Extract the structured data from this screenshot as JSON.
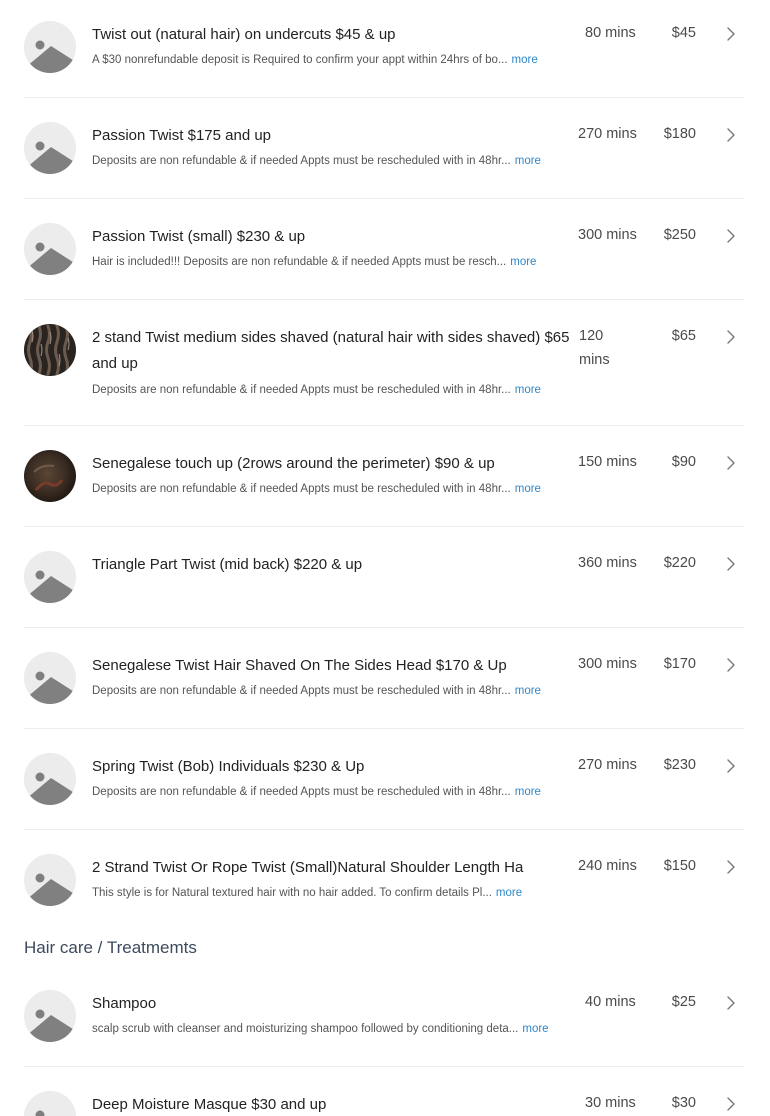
{
  "colors": {
    "link": "#2f87c8",
    "divider": "#eeeeee",
    "section": "#3c4b5c"
  },
  "services": [
    {
      "title": "Twist out (natural hair) on undercuts $45 & up",
      "desc": "A $30 nonrefundable deposit  is Required to confirm your appt  within 24hrs of bo...",
      "more": "more",
      "duration": "80 mins",
      "price": "$45",
      "thumb": "placeholder-image-icon"
    },
    {
      "title": "Passion Twist $175 and up",
      "desc": "Deposits are non refundable  & if  needed Appts must be rescheduled  with in 48hr...",
      "more": "more",
      "duration": "270 mins",
      "price": "$180",
      "thumb": "placeholder-image-icon"
    },
    {
      "title": "Passion Twist (small) $230 & up",
      "desc": "Hair is included!!! Deposits are non refundable  & if  needed Appts must be resch...",
      "more": "more",
      "duration": "300 mins",
      "price": "$250",
      "thumb": "placeholder-image-icon"
    },
    {
      "title": "2 stand Twist medium sides shaved  (natural hair with sides shaved) $65 and up",
      "desc": "Deposits are non refundable  & if  needed Appts must be rescheduled  with in 48hr...",
      "more": "more",
      "duration": "120 mins",
      "price": "$65",
      "thumb": "hairstyle-photo"
    },
    {
      "title": "Senegalese touch up (2rows around the perimeter) $90 & up",
      "desc": "Deposits are non refundable  & if  needed Appts must be rescheduled  with in 48hr...",
      "more": "more",
      "duration": "150 mins",
      "price": "$90",
      "thumb": "hairstyle-photo"
    },
    {
      "title": "Triangle  Part Twist (mid back)  $220 & up",
      "desc": "",
      "more": "",
      "duration": "360 mins",
      "price": "$220",
      "thumb": "placeholder-image-icon"
    },
    {
      "title": "Senegalese Twist Hair Shaved On The Sides Head $170 & Up",
      "desc": "Deposits are non refundable  & if  needed Appts must be rescheduled  with in 48hr...",
      "more": "more",
      "duration": "300 mins",
      "price": "$170",
      "thumb": "placeholder-image-icon"
    },
    {
      "title": "Spring Twist (Bob) Individuals $230 & Up",
      "desc": "Deposits are non refundable  & if  needed Appts must be rescheduled  with in 48hr...",
      "more": "more",
      "duration": "270 mins",
      "price": "$230",
      "thumb": "placeholder-image-icon"
    },
    {
      "title": "2 Strand Twist Or Rope Twist (Small)Natural Shoulder Length Ha",
      "desc": "This style is for Natural textured hair with no hair added. To confirm details Pl...",
      "more": "more",
      "duration": "240 mins",
      "price": "$150",
      "thumb": "placeholder-image-icon"
    }
  ],
  "section_title": "Hair care / Treatmemts",
  "section_services": [
    {
      "title": "Shampoo",
      "desc": "scalp scrub with cleanser  and moisturizing shampoo followed by conditioning deta...",
      "more": "more",
      "duration": "40 mins",
      "price": "$25",
      "thumb": "placeholder-image-icon"
    },
    {
      "title": "Deep Moisture Masque $30 and up",
      "desc": "",
      "more": "",
      "duration": "30 mins",
      "price": "$30",
      "thumb": "placeholder-image-icon"
    }
  ]
}
